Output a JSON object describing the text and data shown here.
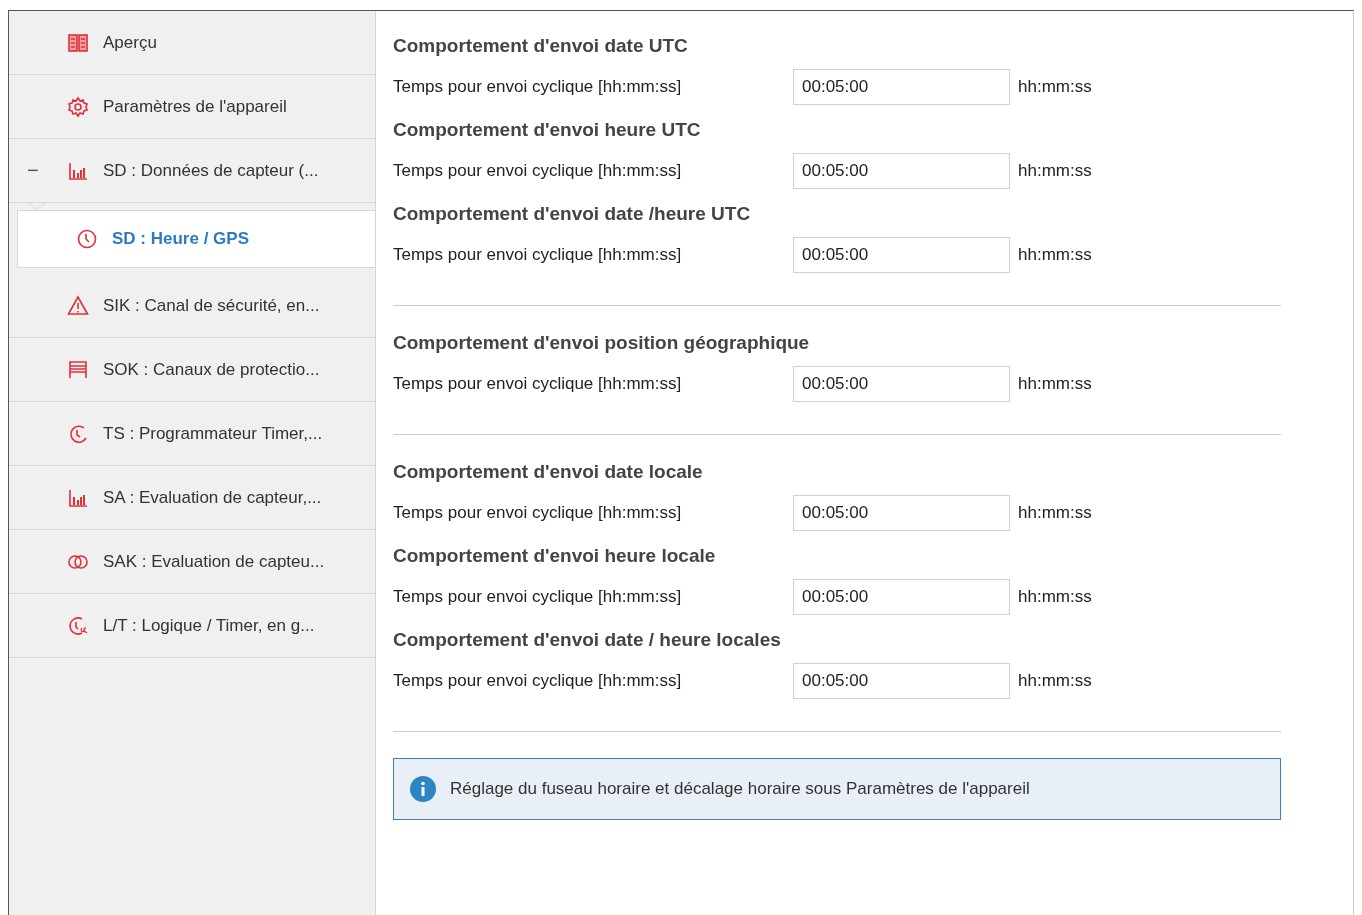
{
  "sidebar": {
    "items": [
      {
        "kind": "book",
        "label": "Aperçu",
        "selected": false
      },
      {
        "kind": "gear",
        "label": "Paramètres de l'appareil",
        "selected": false
      },
      {
        "kind": "chart",
        "label": "SD : Données de capteur (...",
        "selected": false,
        "expanded": true,
        "toggle": "−",
        "children": [
          {
            "kind": "clock",
            "label": "SD : Heure / GPS",
            "selected": true
          }
        ]
      },
      {
        "kind": "warning",
        "label": "SIK : Canal de sécurité, en...",
        "selected": false
      },
      {
        "kind": "shutter",
        "label": "SOK : Canaux de protectio...",
        "selected": false
      },
      {
        "kind": "timer",
        "label": "TS : Programmateur Timer,...",
        "selected": false
      },
      {
        "kind": "chart",
        "label": "SA : Evaluation de capteur,...",
        "selected": false
      },
      {
        "kind": "rings",
        "label": "SAK : Evaluation de capteu...",
        "selected": false
      },
      {
        "kind": "logic",
        "label": "L/T : Logique / Timer, en g...",
        "selected": false
      }
    ]
  },
  "groups": [
    {
      "sections": [
        {
          "heading": "Comportement d'envoi date UTC",
          "label": "Temps pour envoi cyclique [hh:mm:ss]",
          "value": "00:05:00",
          "unit": "hh:mm:ss"
        },
        {
          "heading": "Comportement d'envoi heure UTC",
          "label": "Temps pour envoi cyclique [hh:mm:ss]",
          "value": "00:05:00",
          "unit": "hh:mm:ss"
        },
        {
          "heading": "Comportement d'envoi date /heure UTC",
          "label": "Temps pour envoi cyclique [hh:mm:ss]",
          "value": "00:05:00",
          "unit": "hh:mm:ss"
        }
      ]
    },
    {
      "sections": [
        {
          "heading": "Comportement d'envoi position géographique",
          "label": "Temps pour envoi cyclique [hh:mm:ss]",
          "value": "00:05:00",
          "unit": "hh:mm:ss"
        }
      ]
    },
    {
      "sections": [
        {
          "heading": "Comportement d'envoi date locale",
          "label": "Temps pour envoi cyclique [hh:mm:ss]",
          "value": "00:05:00",
          "unit": "hh:mm:ss"
        },
        {
          "heading": "Comportement d'envoi heure locale",
          "label": "Temps pour envoi cyclique [hh:mm:ss]",
          "value": "00:05:00",
          "unit": "hh:mm:ss"
        },
        {
          "heading": "Comportement d'envoi date / heure locales",
          "label": "Temps pour envoi cyclique [hh:mm:ss]",
          "value": "00:05:00",
          "unit": "hh:mm:ss"
        }
      ]
    }
  ],
  "info": {
    "text": "Réglage du fuseau horaire et décalage horaire sous Paramètres de l'appareil"
  }
}
